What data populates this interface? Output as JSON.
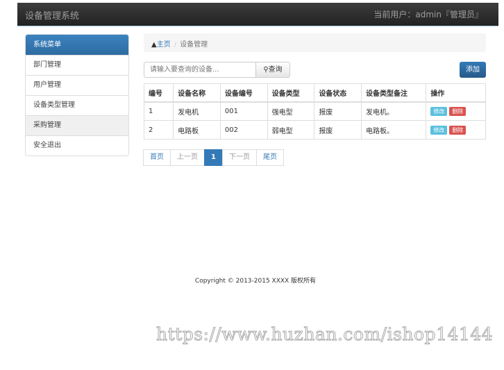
{
  "navbar": {
    "brand": "设备管理系统",
    "user": "当前用户：admin『管理员』"
  },
  "sidebar": {
    "title": "系统菜单",
    "items": [
      "部门管理",
      "用户管理",
      "设备类型管理",
      "采购管理",
      "安全退出"
    ]
  },
  "breadcrumb": {
    "home": "主页",
    "current": "设备管理"
  },
  "search": {
    "placeholder": "请输入要查询的设备...",
    "button": "查询"
  },
  "add_label": "添加",
  "table": {
    "headers": [
      "编号",
      "设备名称",
      "设备编号",
      "设备类型",
      "设备状态",
      "设备类型备注",
      "操作"
    ],
    "rows": [
      [
        "1",
        "发电机",
        "001",
        "强电型",
        "报废",
        "发电机。"
      ],
      [
        "2",
        "电路板",
        "002",
        "弱电型",
        "报废",
        "电路板。"
      ]
    ],
    "edit": "修改",
    "delete": "删除"
  },
  "pagination": [
    "首页",
    "上一页",
    "1",
    "下一页",
    "尾页"
  ],
  "footer": "Copyright © 2013-2015 XXXX 版权所有",
  "watermark": "https://www.huzhan.com/ishop14144"
}
